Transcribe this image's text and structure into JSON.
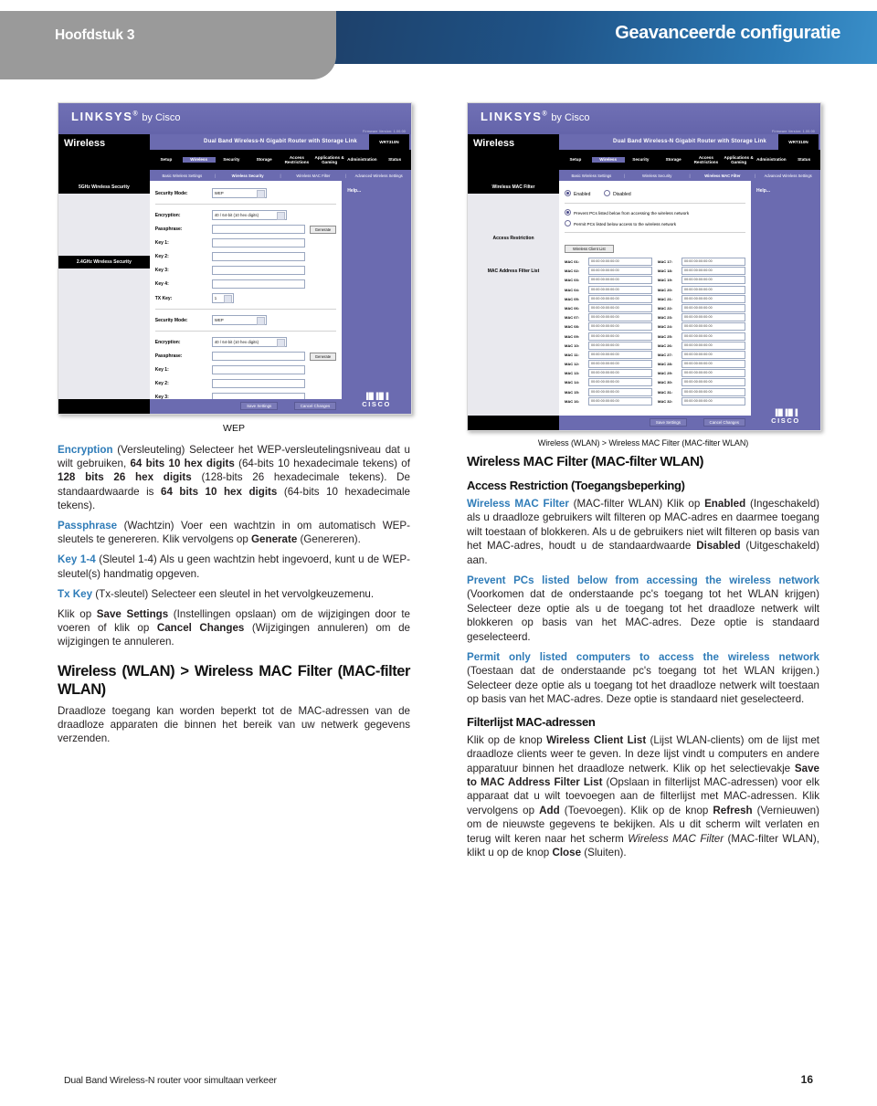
{
  "header": {
    "chapter": "Hoofdstuk 3",
    "title": "Geavanceerde configuratie",
    "gray_hex": "#9a9a9a",
    "blue_hex": "#1d3557",
    "blue_hex_right": "#3a8fc9"
  },
  "screenshot_left": {
    "caption": "WEP",
    "brand": "LINKSYS",
    "brand_reg": "®",
    "brand_by": "by Cisco",
    "firmware": "Firmware Version: 1.00.00",
    "model_bar": "Dual Band Wireless-N Gigabit Router with Storage Link",
    "model_code": "WRT310N",
    "section": "Wireless",
    "tabs": [
      "Setup",
      "Wireless",
      "Security",
      "Storage",
      "Access Restrictions",
      "Applications & Gaming",
      "Administration",
      "Status"
    ],
    "selected_tab": "Wireless",
    "subtabs": [
      "Basic Wireless Settings",
      "Wireless Security",
      "Wireless MAC Filter",
      "Advanced Wireless Settings"
    ],
    "selected_subtab": "Wireless Security",
    "help_label": "Help...",
    "cisco_bars": "▐█▐█▐",
    "cisco_name": "CISCO",
    "panel1_label": "5GHz Wireless Security",
    "panel2_label": "2.4GHz Wireless Security",
    "fields": {
      "security_mode_label": "Security Mode:",
      "security_mode_value": "WEP",
      "encryption_label": "Encryption:",
      "encryption_value": "40 / 64-bit (10 hex digits)",
      "passphrase_label": "Passphrase:",
      "passphrase_value": "",
      "generate_button": "Generate",
      "key1_label": "Key 1:",
      "key2_label": "Key 2:",
      "key3_label": "Key 3:",
      "key4_label": "Key 4:",
      "txkey_label": "TX Key:",
      "txkey_value": "1"
    },
    "save_button": "Save Settings",
    "cancel_button": "Cancel Changes"
  },
  "screenshot_right": {
    "caption": "Wireless (WLAN) > Wireless MAC Filter (MAC-filter WLAN)",
    "brand": "LINKSYS",
    "brand_reg": "®",
    "brand_by": "by Cisco",
    "firmware": "Firmware Version: 1.00.00",
    "model_bar": "Dual Band Wireless-N Gigabit Router with Storage Link",
    "model_code": "WRT310N",
    "section": "Wireless",
    "tabs": [
      "Setup",
      "Wireless",
      "Security",
      "Storage",
      "Access Restrictions",
      "Applications & Gaming",
      "Administration",
      "Status"
    ],
    "selected_tab": "Wireless",
    "subtabs": [
      "Basic Wireless Settings",
      "Wireless Security",
      "Wireless MAC Filter",
      "Advanced Wireless Settings"
    ],
    "selected_subtab": "Wireless MAC Filter",
    "help_label": "Help...",
    "cisco_bars": "▐█▐█▐",
    "cisco_name": "CISCO",
    "sidebar": [
      "Wireless MAC Filter",
      "Access Restriction",
      "MAC Address Filter List"
    ],
    "enabled_label": "Enabled",
    "disabled_label": "Disabled",
    "option_prevent": "Prevent PCs listed below from accessing the wireless network",
    "option_permit": "Permit PCs listed below access to the wireless network",
    "client_list_button": "Wireless Client List",
    "mac_placeholder": "00:00:00:00:00:00",
    "mac_labels_left": [
      "MAC 01:",
      "MAC 02:",
      "MAC 03:",
      "MAC 04:",
      "MAC 05:",
      "MAC 06:",
      "MAC 07:",
      "MAC 08:",
      "MAC 09:",
      "MAC 10:",
      "MAC 11:",
      "MAC 12:",
      "MAC 13:",
      "MAC 14:",
      "MAC 15:",
      "MAC 16:"
    ],
    "mac_labels_right": [
      "MAC 17:",
      "MAC 18:",
      "MAC 19:",
      "MAC 20:",
      "MAC 21:",
      "MAC 22:",
      "MAC 23:",
      "MAC 24:",
      "MAC 25:",
      "MAC 26:",
      "MAC 27:",
      "MAC 28:",
      "MAC 29:",
      "MAC 30:",
      "MAC 31:",
      "MAC 32:"
    ],
    "save_button": "Save Settings",
    "cancel_button": "Cancel Changes"
  },
  "left_column": {
    "p_encryption": {
      "term": "Encryption",
      "rest_1": " (Versleuteling) Selecteer het WEP-versleutelingsniveau dat u wilt gebruiken, ",
      "b1": "64 bits 10 hex digits",
      "rest_2": " (64-bits 10 hexadecimale tekens) of ",
      "b2": "128 bits 26 hex digits",
      "rest_3": " (128-bits 26 hexadecimale tekens). De standaardwaarde is ",
      "b3": "64 bits 10 hex digits",
      "rest_4": " (64-bits 10 hexadecimale tekens)."
    },
    "p_passphrase": {
      "term": "Passphrase",
      "rest_1": " (Wachtzin) Voer een wachtzin in om automatisch WEP-sleutels te genereren. Klik vervolgens op ",
      "b1": "Generate",
      "rest_2": " (Genereren)."
    },
    "p_key": {
      "term": "Key 1-4",
      "rest_1": " (Sleutel 1-4)  Als u geen wachtzin hebt ingevoerd, kunt u de WEP-sleutel(s) handmatig opgeven."
    },
    "p_txkey": {
      "term": "Tx Key",
      "rest_1": " (Tx-sleutel) Selecteer een sleutel in het vervolgkeuzemenu."
    },
    "p_save": {
      "t1": "Klik op ",
      "b1": "Save Settings",
      "t2": " (Instellingen opslaan) om de wijzigingen door te voeren of klik op ",
      "b2": "Cancel Changes",
      "t3": " (Wijzigingen annuleren) om de wijzigingen te annuleren."
    },
    "heading": "Wireless (WLAN) > Wireless MAC Filter (MAC-filter WLAN)",
    "p_intro": "Draadloze toegang kan worden beperkt tot de MAC-adressen van de draadloze apparaten die binnen het bereik van uw netwerk gegevens verzenden."
  },
  "right_column": {
    "heading_main": "Wireless MAC Filter (MAC-filter WLAN)",
    "heading_sub": "Access Restriction (Toegangsbeperking)",
    "p_filter": {
      "term": "Wireless MAC Filter",
      "t1": "  (MAC-filter WLAN)  Klik op ",
      "b1": "Enabled",
      "t2": " (Ingeschakeld) als u draadloze gebruikers wilt filteren op MAC-adres en daarmee toegang wilt toestaan of blokkeren. Als u de gebruikers niet wilt filteren op basis van het MAC-adres, houdt u de standaardwaarde ",
      "b2": "Disabled",
      "t3": " (Uitgeschakeld) aan."
    },
    "p_prevent": {
      "term": "Prevent PCs listed below from accessing the wireless network",
      "t1": "  (Voorkomen dat de onderstaande pc's toegang tot het WLAN krijgen) Selecteer deze optie als u de toegang tot het draadloze netwerk wilt blokkeren op basis van het MAC-adres. Deze optie is standaard geselecteerd."
    },
    "p_permit": {
      "term": "Permit only listed computers to access the wireless network",
      "t1": " (Toestaan dat de onderstaande pc's toegang tot het WLAN krijgen.)  Selecteer deze optie als u toegang tot het draadloze netwerk wilt toestaan op basis van het MAC-adres. Deze optie is standaard niet geselecteerd."
    },
    "heading_list": "Filterlijst MAC-adressen",
    "p_list": {
      "t1": "Klik op de knop ",
      "b1": "Wireless Client List",
      "t2": " (Lijst WLAN-clients) om de lijst met draadloze clients weer te geven. In deze lijst vindt u computers en andere apparatuur binnen het draadloze netwerk. Klik op het selectievakje ",
      "b2": "Save to MAC Address Filter List",
      "t3": " (Opslaan in filterlijst MAC-adressen) voor elk apparaat dat u wilt toevoegen aan de filterlijst met MAC-adressen. Klik vervolgens op ",
      "b3": "Add",
      "t4": " (Toevoegen). Klik op de knop ",
      "b4": "Refresh",
      "t5": " (Vernieuwen) om de nieuwste gegevens te bekijken. Als u dit scherm wilt verlaten en terug wilt keren naar het scherm ",
      "i1": "Wireless MAC Filter",
      "t6": " (MAC-filter WLAN), klikt u op de knop ",
      "b5": "Close",
      "t7": " (Sluiten)."
    }
  },
  "footer": {
    "product": "Dual Band Wireless-N router voor simultaan verkeer",
    "page": "16"
  }
}
